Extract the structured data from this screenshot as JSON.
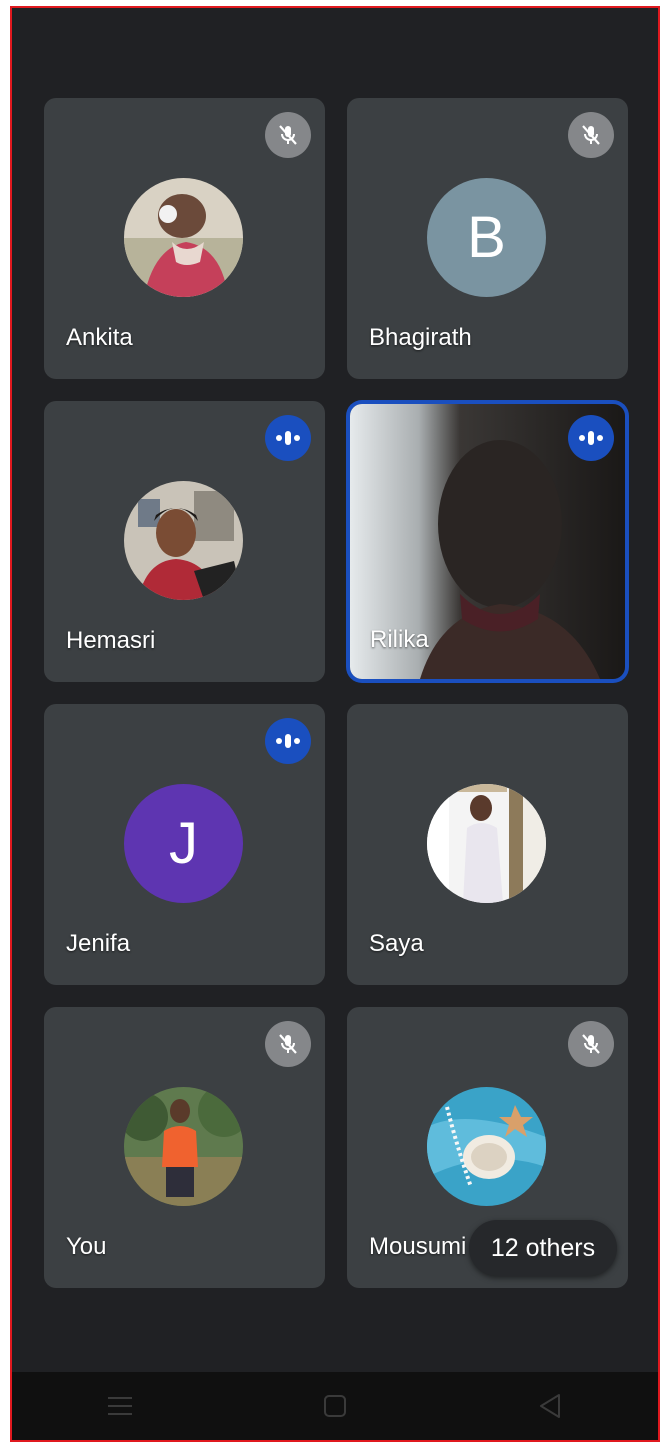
{
  "participants": [
    {
      "name": "Ankita",
      "status": "muted",
      "avatar": "photo-girl-headphones-icon"
    },
    {
      "name": "Bhagirath",
      "status": "muted",
      "avatar": "letter",
      "initial": "B",
      "color": "#7a94a1"
    },
    {
      "name": "Hemasri",
      "status": "speaking",
      "avatar": "photo-woman-selfie-icon"
    },
    {
      "name": "Rilika",
      "status": "speaking",
      "avatar": "live-video",
      "active": true
    },
    {
      "name": "Jenifa",
      "status": "speaking",
      "avatar": "letter",
      "initial": "J",
      "color": "#5e35b1"
    },
    {
      "name": "Saya",
      "status": "none",
      "avatar": "photo-girl-standing-icon"
    },
    {
      "name": "You",
      "status": "muted",
      "avatar": "photo-man-orange-shirt-icon"
    },
    {
      "name": "Mousumi",
      "status": "muted",
      "avatar": "photo-seashell-pearls-icon"
    }
  ],
  "others_chip": {
    "label": "12 others"
  },
  "icons": {
    "muted": "mic-off-icon",
    "speaking": "audio-level-icon",
    "nav_menu": "menu-icon",
    "nav_home": "home-square-icon",
    "nav_back": "back-triangle-icon"
  },
  "colors": {
    "background": "#202124",
    "tile": "#3c4043",
    "accent": "#1a4fbf",
    "muted_badge": "#85878a"
  }
}
